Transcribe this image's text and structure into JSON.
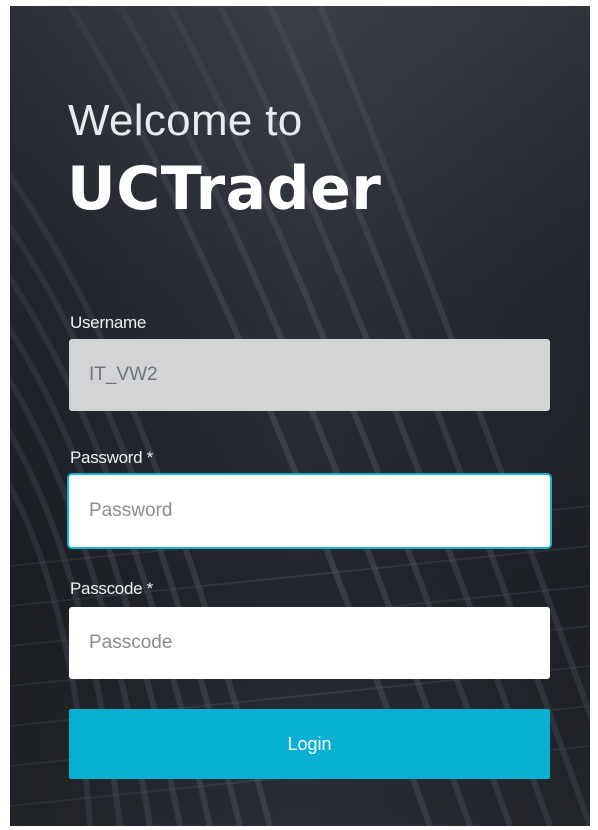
{
  "header": {
    "welcome_text": "Welcome to",
    "brand_name": "UCTrader"
  },
  "form": {
    "username": {
      "label": "Username",
      "value": "IT_VW2",
      "disabled": true
    },
    "password": {
      "label": "Password *",
      "placeholder": "Password",
      "value": ""
    },
    "passcode": {
      "label": "Passcode *",
      "placeholder": "Passcode",
      "value": ""
    },
    "submit_label": "Login"
  },
  "colors": {
    "accent": "#08b1d1",
    "focus_border": "#16b5cf",
    "background": "#2b2f37",
    "disabled_field": "#d3d4d6"
  }
}
